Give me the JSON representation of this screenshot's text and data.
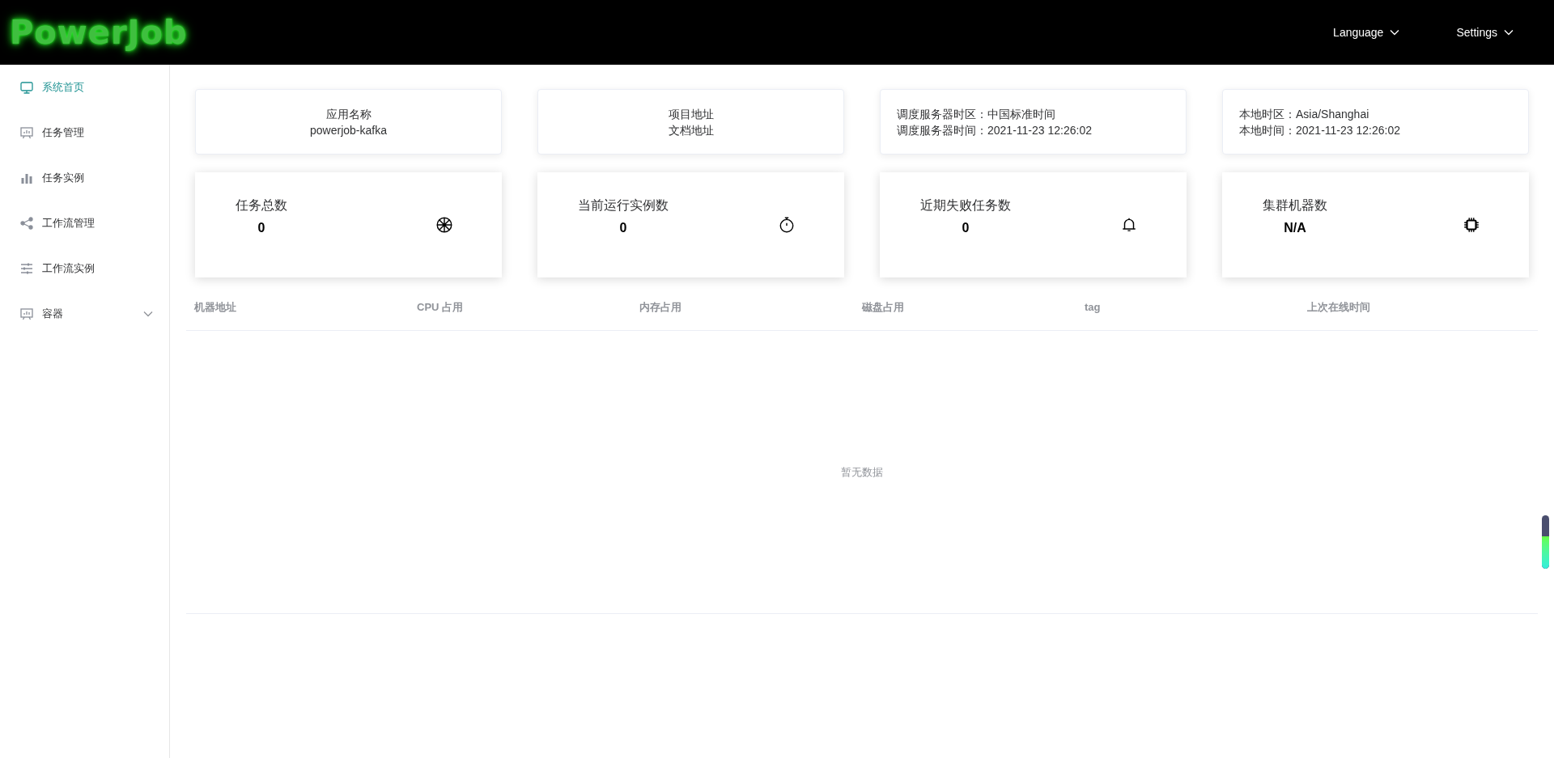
{
  "header": {
    "logo": "PowerJob",
    "menus": [
      {
        "label": "Language"
      },
      {
        "label": "Settings"
      }
    ]
  },
  "sidebar": {
    "items": [
      {
        "label": "系统首页",
        "selected": true,
        "expandable": false
      },
      {
        "label": "任务管理",
        "selected": false,
        "expandable": false
      },
      {
        "label": "任务实例",
        "selected": false,
        "expandable": false
      },
      {
        "label": "工作流管理",
        "selected": false,
        "expandable": false
      },
      {
        "label": "工作流实例",
        "selected": false,
        "expandable": false
      },
      {
        "label": "容器",
        "selected": false,
        "expandable": true
      }
    ]
  },
  "info_cards": [
    {
      "kind": "center",
      "lines": [
        "应用名称",
        "powerjob-kafka"
      ]
    },
    {
      "kind": "center",
      "lines": [
        "项目地址",
        "文档地址"
      ]
    },
    {
      "kind": "left",
      "lines": [
        "调度服务器时区：中国标准时间",
        "调度服务器时间：2021-11-23 12:26:02"
      ]
    },
    {
      "kind": "left",
      "lines": [
        "本地时区：Asia/Shanghai",
        "本地时间：2021-11-23 12:26:02"
      ]
    }
  ],
  "stat_cards": [
    {
      "label": "任务总数",
      "value": "0"
    },
    {
      "label": "当前运行实例数",
      "value": "0"
    },
    {
      "label": "近期失败任务数",
      "value": "0"
    },
    {
      "label": "集群机器数",
      "value": "N/A"
    }
  ],
  "table": {
    "columns": [
      "机器地址",
      "CPU 占用",
      "内存占用",
      "磁盘占用",
      "tag",
      "上次在线时间"
    ],
    "empty_text": "暂无数据"
  }
}
